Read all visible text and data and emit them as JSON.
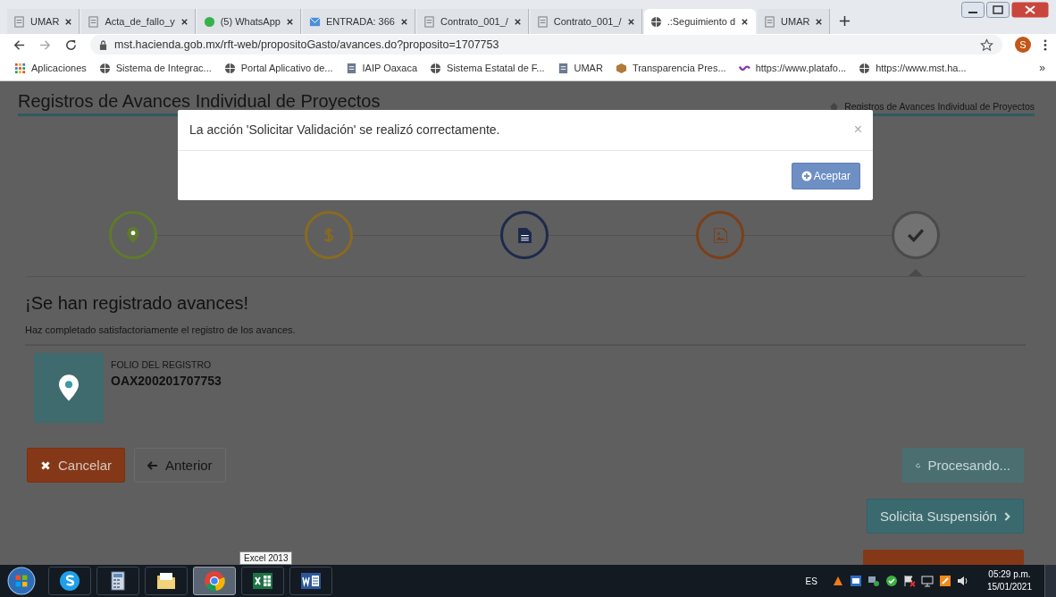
{
  "browser": {
    "tabs": [
      {
        "label": "UMAR",
        "kind": "doc",
        "selected": false
      },
      {
        "label": "Acta_de_fallo_y",
        "kind": "doc",
        "selected": false
      },
      {
        "label": "(5) WhatsApp",
        "kind": "chat",
        "selected": false
      },
      {
        "label": "ENTRADA: 366",
        "kind": "mail",
        "selected": false
      },
      {
        "label": "Contrato_001_/",
        "kind": "doc",
        "selected": false
      },
      {
        "label": "Contrato_001_/",
        "kind": "doc",
        "selected": false
      },
      {
        "label": ".:Seguimiento d",
        "kind": "globe",
        "selected": true
      },
      {
        "label": "UMAR",
        "kind": "doc",
        "selected": false
      }
    ],
    "address": "mst.hacienda.gob.mx/rft-web/propositoGasto/avances.do?proposito=1707753",
    "profile": "S",
    "bookmarks": [
      {
        "label": "Aplicaciones",
        "kind": "apps"
      },
      {
        "label": "Sistema de Integrac...",
        "kind": "globe"
      },
      {
        "label": "Portal Aplicativo de...",
        "kind": "globe"
      },
      {
        "label": "IAIP Oaxaca",
        "kind": "doc"
      },
      {
        "label": "Sistema Estatal de F...",
        "kind": "globe"
      },
      {
        "label": "UMAR",
        "kind": "doc"
      },
      {
        "label": "Transparencia Pres...",
        "kind": "box"
      },
      {
        "label": "https://www.platafo...",
        "kind": "wave"
      },
      {
        "label": "https://www.mst.ha...",
        "kind": "globe"
      }
    ],
    "bookmarks_more": "»"
  },
  "page": {
    "title": "Registros de Avances Individual de Proyectos",
    "breadcrumb": "Registros de Avances Individual de Proyectos",
    "steps": [
      {
        "kind": "pin",
        "color": "#5f7a2c",
        "selected": false
      },
      {
        "kind": "dollar",
        "color": "#8a6a20",
        "selected": false
      },
      {
        "kind": "file",
        "color": "#1e2a4c",
        "selected": false
      },
      {
        "kind": "image",
        "color": "#7d3f17",
        "selected": false
      },
      {
        "kind": "check",
        "color": "#4a4a4a",
        "selected": true
      }
    ],
    "heading": "¡Se han registrado avances!",
    "subtext": "Haz completado satisfactoriamente el registro de los avances.",
    "folio_label": "FOLIO DEL REGISTRO",
    "folio": "OAX200201707753",
    "buttons": [
      {
        "label": "Cancelar",
        "kind": "cancel",
        "disabled": false
      },
      {
        "label": "Anterior",
        "kind": "back",
        "disabled": false
      },
      {
        "label": "Procesando...",
        "kind": "processing",
        "disabled": true
      },
      {
        "label": "Solicita Suspensión",
        "kind": "next",
        "disabled": false
      }
    ]
  },
  "modal": {
    "message": "La acción 'Solicitar Validación' se realizó correctamente.",
    "close": "×",
    "button": "Aceptar"
  },
  "taskbar": {
    "apps": [
      {
        "kind": "skype",
        "selected": false
      },
      {
        "kind": "calculator",
        "selected": false
      },
      {
        "kind": "folder",
        "selected": false
      },
      {
        "kind": "chrome",
        "selected": true
      },
      {
        "kind": "excel",
        "selected": false
      },
      {
        "kind": "word",
        "selected": false
      }
    ],
    "tooltip": "Excel 2013",
    "language": "ES",
    "time": "05:29 p.m.",
    "date": "15/01/2021"
  }
}
